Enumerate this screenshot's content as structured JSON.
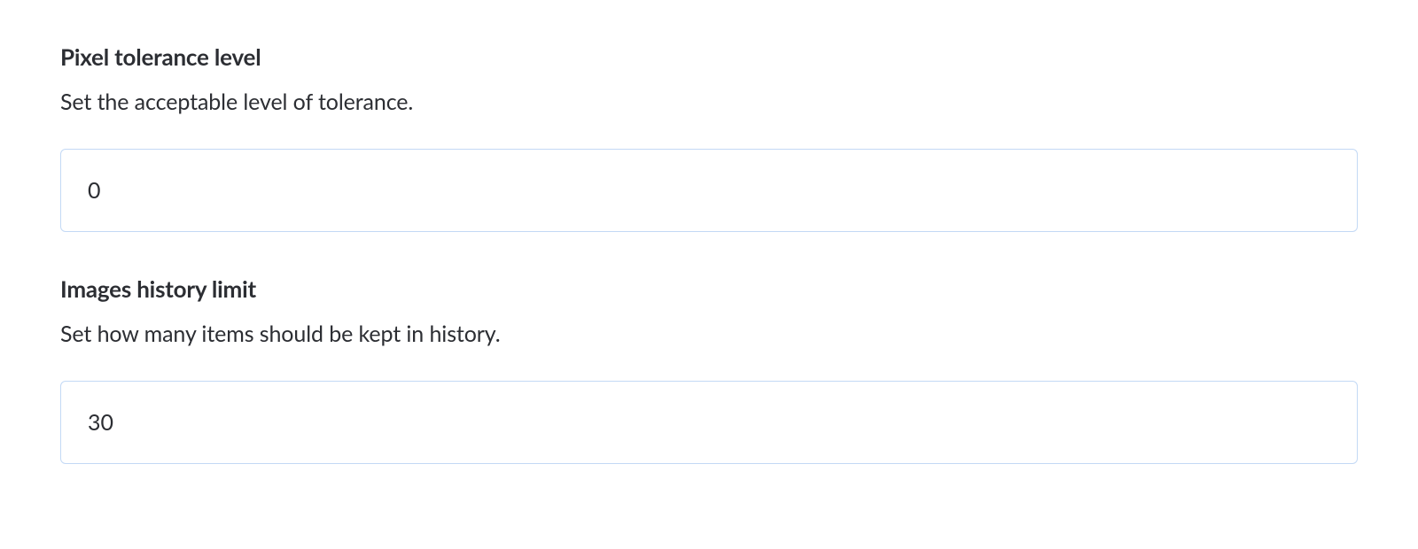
{
  "settings": {
    "pixelTolerance": {
      "title": "Pixel tolerance level",
      "description": "Set the acceptable level of tolerance.",
      "value": "0"
    },
    "historyLimit": {
      "title": "Images history limit",
      "description": "Set how many items should be kept in history.",
      "value": "30"
    }
  }
}
